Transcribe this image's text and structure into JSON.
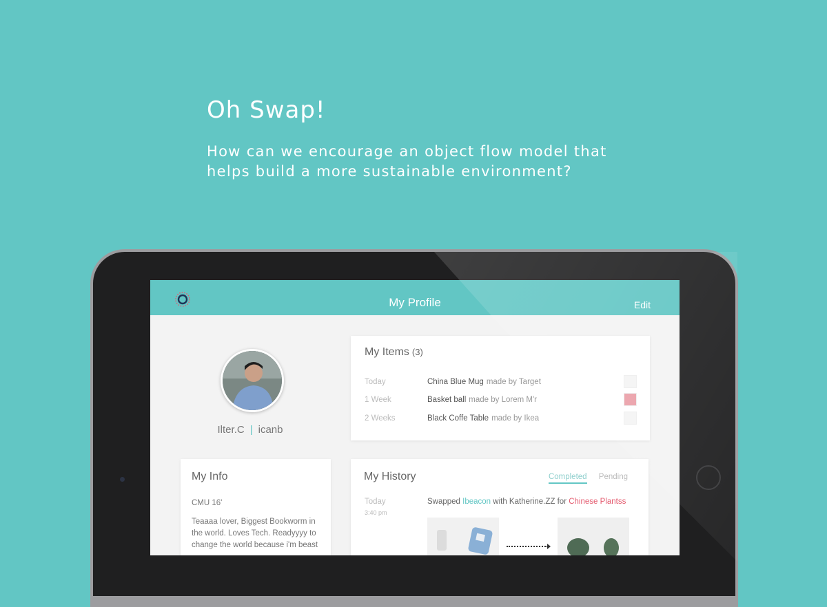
{
  "hero": {
    "title": "Oh Swap!",
    "subtitle": "How can we encourage an object flow model that helps build a more sustainable environment?"
  },
  "app": {
    "header_title": "My Profile",
    "edit_label": "Edit",
    "accent": "#62c6c4"
  },
  "profile": {
    "name": "Ilter.C",
    "handle": "icanb"
  },
  "items": {
    "title": "My Items",
    "count": "(3)",
    "rows": [
      {
        "time": "Today",
        "name": "China Blue Mug",
        "made": "made by Target"
      },
      {
        "time": "1 Week",
        "name": "Basket ball",
        "made": "made by Lorem M'r"
      },
      {
        "time": "2 Weeks",
        "name": "Black Coffe Table",
        "made": "made by Ikea"
      }
    ]
  },
  "info": {
    "title": "My Info",
    "school": "CMU 16'",
    "bio": "Teaaaa lover, Biggest Bookworm in the world. Loves Tech. Readyyyy to change the world because i'm beast"
  },
  "history": {
    "title": "My History",
    "tabs": [
      "Completed",
      "Pending"
    ],
    "entry": {
      "date": "Today",
      "time": "3:40 pm",
      "prefix": "Swapped ",
      "item": "Ibeacon",
      "middle": " with Katherine.ZZ for ",
      "other_item": "Chinese Plantss"
    }
  }
}
